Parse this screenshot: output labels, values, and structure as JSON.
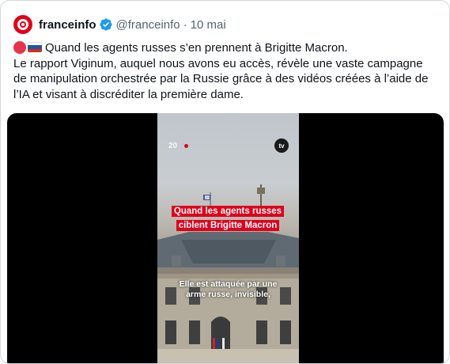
{
  "tweet": {
    "author_name": "franceinfo",
    "handle": "@franceinfo",
    "separator": "·",
    "date": "10 mai",
    "text_line1": "Quand les agents russes s’en prennent à Brigitte Macron.",
    "text_line2": "Le rapport Viginum, auquel nous avons eu accès, révèle une vaste campagne",
    "text_line3": "de manipulation orchestrée par la Russie grâce à des vidéos créées à l’aide de",
    "text_line4": "l’IA et visant à discréditer la première dame."
  },
  "video": {
    "timer": "20",
    "logo": "tv",
    "title_line1": "Quand les agents russes",
    "title_line2": "ciblent Brigitte Macron",
    "subtitle_line1": "Elle est attaquée par une",
    "subtitle_line2": "arme russe, invisible,"
  },
  "colors": {
    "brand_red": "#e0001b",
    "verified_blue": "#1d9bf0",
    "muted_text": "#536471",
    "border": "#cfd9de"
  },
  "icons": {
    "verified": "verified-badge-icon",
    "emoji1": "red-circle-emoji",
    "emoji2": "russia-flag-emoji"
  }
}
